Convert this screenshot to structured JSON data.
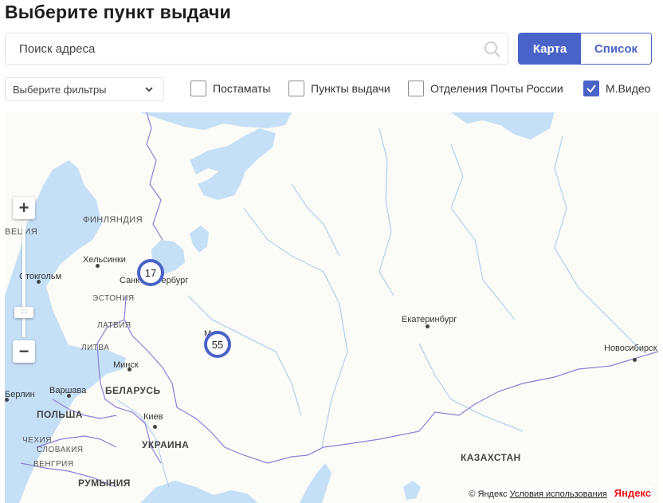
{
  "page_title": "Выберите пункт выдачи",
  "search": {
    "placeholder": "Поиск адреса",
    "value": ""
  },
  "view_toggle": {
    "map_label": "Карта",
    "list_label": "Список",
    "active": "map"
  },
  "filters": {
    "select_label": "Выберите фильтры",
    "checkboxes": [
      {
        "label": "Постаматы",
        "checked": false
      },
      {
        "label": "Пункты выдачи",
        "checked": false
      },
      {
        "label": "Отделения Почты России",
        "checked": false
      },
      {
        "label": "М.Видео",
        "checked": true
      }
    ]
  },
  "map": {
    "zoom": {
      "plus": "+",
      "minus": "−",
      "knob": "::::"
    },
    "clusters": [
      {
        "count": "17"
      },
      {
        "count": "55"
      }
    ],
    "labels": {
      "finland": "ФИНЛЯНДИЯ",
      "sweden": "ВЕЦИЯ",
      "helsinki": "Хельсинки",
      "stockholm": "Стокгольм",
      "spb": "Санкт-Петербург",
      "estonia": "ЭСТОНИЯ",
      "latvia": "ЛАТВИЯ",
      "lithuania": "ЛИТВА",
      "minsk": "Минск",
      "belarus": "БЕЛАРУСЬ",
      "berlin": "Берлин",
      "warsaw": "Варшава",
      "poland": "ПОЛЬША",
      "kiev": "Киев",
      "ukraine": "УКРАИНА",
      "czech": "ЧЕХИЯ",
      "slovakia": "СЛОВАКИЯ",
      "hungary": "ВЕНГРИЯ",
      "romania": "РУМЫНИЯ",
      "moscow": "М",
      "yekaterinburg": "Екатеринбург",
      "novosibirsk": "Новосибирск",
      "kazakhstan": "КАЗАХСТАН"
    },
    "copyright": "© Яндекс",
    "terms": "Условия использования",
    "logo": "Яндекс"
  },
  "colors": {
    "accent": "#4a63c8",
    "water": "#c5dff6",
    "land": "#fbfbf7",
    "border": "#8d7ed8"
  },
  "icons": {
    "search": "search-icon",
    "chevron": "chevron-down-icon",
    "check": "check-icon"
  }
}
